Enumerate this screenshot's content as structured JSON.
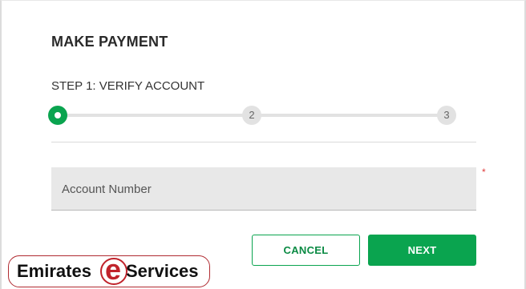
{
  "page": {
    "title": "MAKE PAYMENT",
    "step_label": "STEP 1: VERIFY ACCOUNT"
  },
  "stepper": {
    "steps": [
      {
        "label": "",
        "state": "active"
      },
      {
        "label": "2",
        "state": "inactive"
      },
      {
        "label": "3",
        "state": "inactive"
      }
    ],
    "active_color": "#0aa44f",
    "inactive_color": "#e2e2e2"
  },
  "form": {
    "account_number_label": "Account Number",
    "required_marker": "*"
  },
  "actions": {
    "cancel_label": "CANCEL",
    "next_label": "NEXT",
    "accent_color": "#0aa44f"
  },
  "watermark": {
    "left_text": "Emirates",
    "mid_letter": "e",
    "right_text": "Services",
    "color": "#c0232b"
  }
}
